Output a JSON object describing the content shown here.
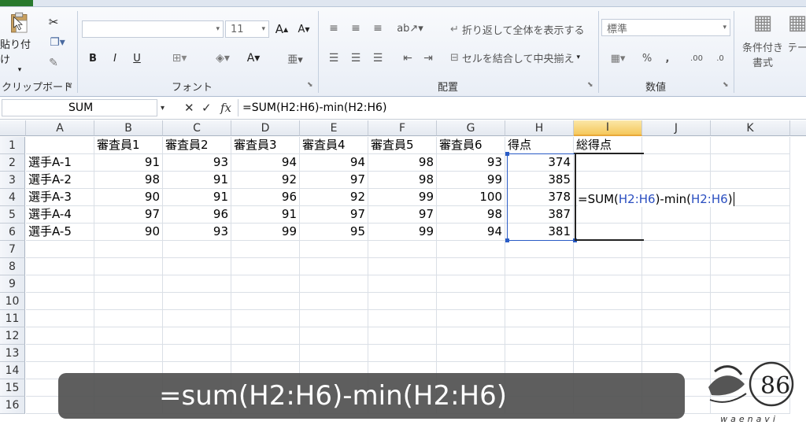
{
  "ribbon": {
    "clipboard": {
      "paste_label": "貼り付け",
      "group_label": "クリップボード"
    },
    "font": {
      "font_name": "",
      "font_size": "11",
      "bold": "B",
      "italic": "I",
      "underline": "U",
      "group_label": "フォント"
    },
    "alignment": {
      "wrap_text_label": "折り返して全体を表示する",
      "merge_center_label": "セルを結合して中央揃え",
      "group_label": "配置"
    },
    "number": {
      "format_value": "標準",
      "percent": "%",
      "comma": ",",
      "group_label": "数値"
    },
    "styles": {
      "conditional_format_line1": "条件付き",
      "conditional_format_line2": "書式",
      "table_label": "テー"
    }
  },
  "formula_bar": {
    "name_box": "SUM",
    "fx_label": "fx",
    "formula": "=SUM(H2:H6)-min(H2:H6)"
  },
  "columns": [
    "A",
    "B",
    "C",
    "D",
    "E",
    "F",
    "G",
    "H",
    "I",
    "J",
    "K"
  ],
  "rows": [
    "1",
    "2",
    "3",
    "4",
    "5",
    "6",
    "7",
    "8",
    "9",
    "10",
    "11",
    "12",
    "13",
    "14",
    "15",
    "16"
  ],
  "sheet": {
    "header_row": [
      "",
      "審査員1",
      "審査員2",
      "審査員3",
      "審査員4",
      "審査員5",
      "審査員6",
      "得点",
      "総得点"
    ],
    "data": [
      {
        "name": "選手A-1",
        "scores": [
          "91",
          "93",
          "94",
          "94",
          "98",
          "93"
        ],
        "total": "374"
      },
      {
        "name": "選手A-2",
        "scores": [
          "98",
          "91",
          "92",
          "97",
          "98",
          "99"
        ],
        "total": "385"
      },
      {
        "name": "選手A-3",
        "scores": [
          "90",
          "91",
          "96",
          "92",
          "99",
          "100"
        ],
        "total": "378"
      },
      {
        "name": "選手A-4",
        "scores": [
          "97",
          "96",
          "91",
          "97",
          "97",
          "98"
        ],
        "total": "387"
      },
      {
        "name": "選手A-5",
        "scores": [
          "90",
          "93",
          "99",
          "95",
          "99",
          "94"
        ],
        "total": "381"
      }
    ]
  },
  "editing_cell": {
    "prefix": "=SUM(",
    "ref1": "H2:H6",
    "middle": ")-min(",
    "ref2": "H2:H6",
    "suffix": ")"
  },
  "caption": "=sum(H2:H6)-min(H2:H6)",
  "logo": {
    "text": "waenavi",
    "mark": "86"
  }
}
